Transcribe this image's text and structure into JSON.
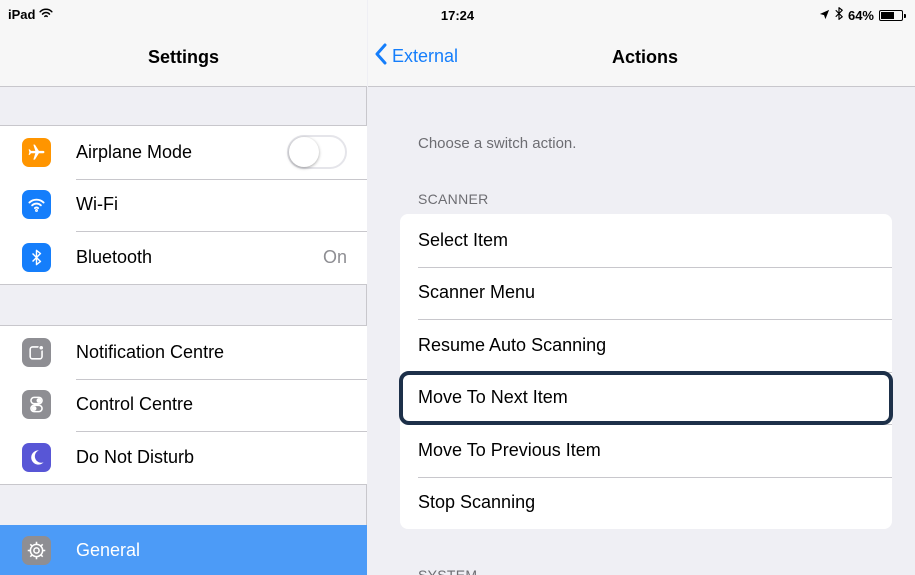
{
  "status_bar": {
    "device": "iPad",
    "time": "17:24",
    "battery": "64%",
    "battery_level": 0.64,
    "icons": [
      "wifi-icon",
      "location-icon",
      "bluetooth-icon",
      "battery-icon"
    ]
  },
  "left": {
    "title": "Settings",
    "group1": [
      {
        "label": "Airplane Mode",
        "icon": "airplane-icon",
        "color": "#ff9500",
        "toggle_on": false
      },
      {
        "label": "Wi-Fi",
        "icon": "wifi-icon",
        "color": "#157efb"
      },
      {
        "label": "Bluetooth",
        "icon": "bluetooth-icon",
        "color": "#157efb",
        "value": "On"
      }
    ],
    "group2": [
      {
        "label": "Notification Centre",
        "icon": "notification-centre-icon",
        "color": "#8e8e93"
      },
      {
        "label": "Control Centre",
        "icon": "control-centre-icon",
        "color": "#8e8e93"
      },
      {
        "label": "Do Not Disturb",
        "icon": "moon-icon",
        "color": "#5856d6"
      }
    ],
    "selected": {
      "label": "General",
      "icon": "gear-icon",
      "color": "#8e8e93",
      "highlight": "#4c9bf7"
    }
  },
  "right": {
    "back_label": "External",
    "title": "Actions",
    "intro": "Choose a switch action.",
    "section_header": "SCANNER",
    "actions": [
      {
        "label": "Select Item"
      },
      {
        "label": "Scanner Menu"
      },
      {
        "label": "Resume Auto Scanning"
      },
      {
        "label": "Move To Next Item",
        "selected": true
      },
      {
        "label": "Move To Previous Item"
      },
      {
        "label": "Stop Scanning"
      }
    ],
    "next_section_header": "SYSTEM"
  },
  "colors": {
    "accent": "#157efb",
    "selection_outline": "#1d3049"
  }
}
